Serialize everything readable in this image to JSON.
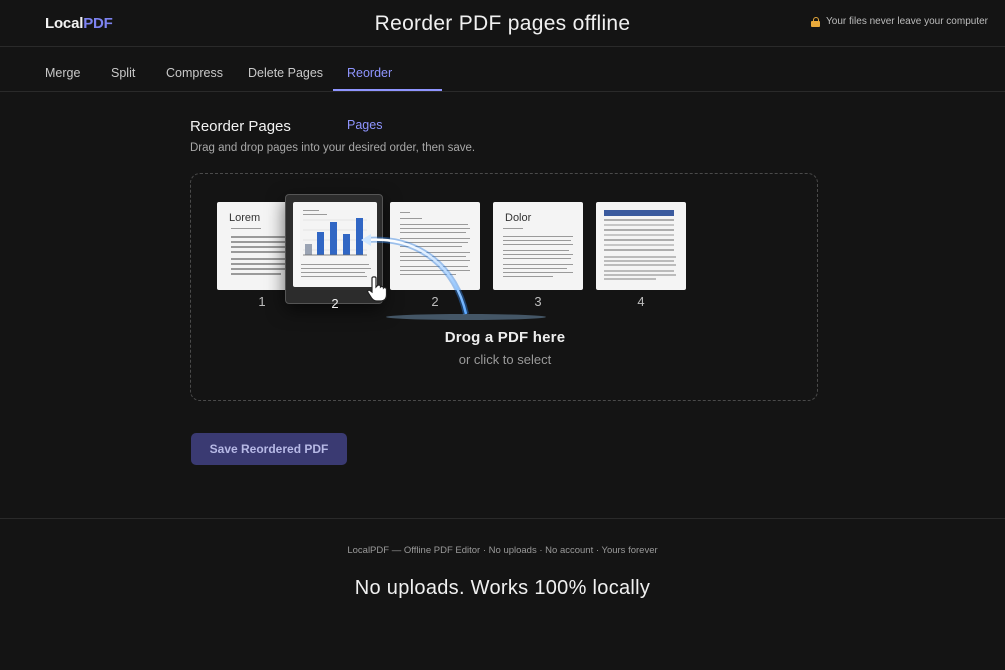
{
  "header": {
    "logo_part1": "Local",
    "logo_part2": "PDF",
    "title": "Reorder PDF pages offline",
    "privacy_text": "Your files never leave your computer",
    "privacy_icon": "lock-icon",
    "accent_color": "#8f95ff"
  },
  "tabs": [
    {
      "label": "Merge",
      "active": false
    },
    {
      "label": "Split",
      "active": false
    },
    {
      "label": "Compress",
      "active": false
    },
    {
      "label": "Delete Pages",
      "active": false
    },
    {
      "label": "Reorder Pages",
      "active": true
    }
  ],
  "section": {
    "title": "Reorder Pages",
    "subtitle": "Drag and drop pages into your desired order, then save."
  },
  "pages": [
    {
      "number": "1",
      "heading": "Lorem"
    },
    {
      "number": "2",
      "heading": "",
      "state": "dragging"
    },
    {
      "number": "2",
      "heading": ""
    },
    {
      "number": "3",
      "heading": "Dolor"
    },
    {
      "number": "4",
      "heading": ""
    }
  ],
  "dropzone": {
    "main_text": "Drog a PDF here",
    "sub_text": "or click to select"
  },
  "save_button": {
    "label": "Save Reordered PDF"
  },
  "footer": {
    "text": "LocalPDF — Offline PDF Editor · No uploads · No account · Yours forever",
    "tagline": "No uploads. Works 100% locally"
  }
}
